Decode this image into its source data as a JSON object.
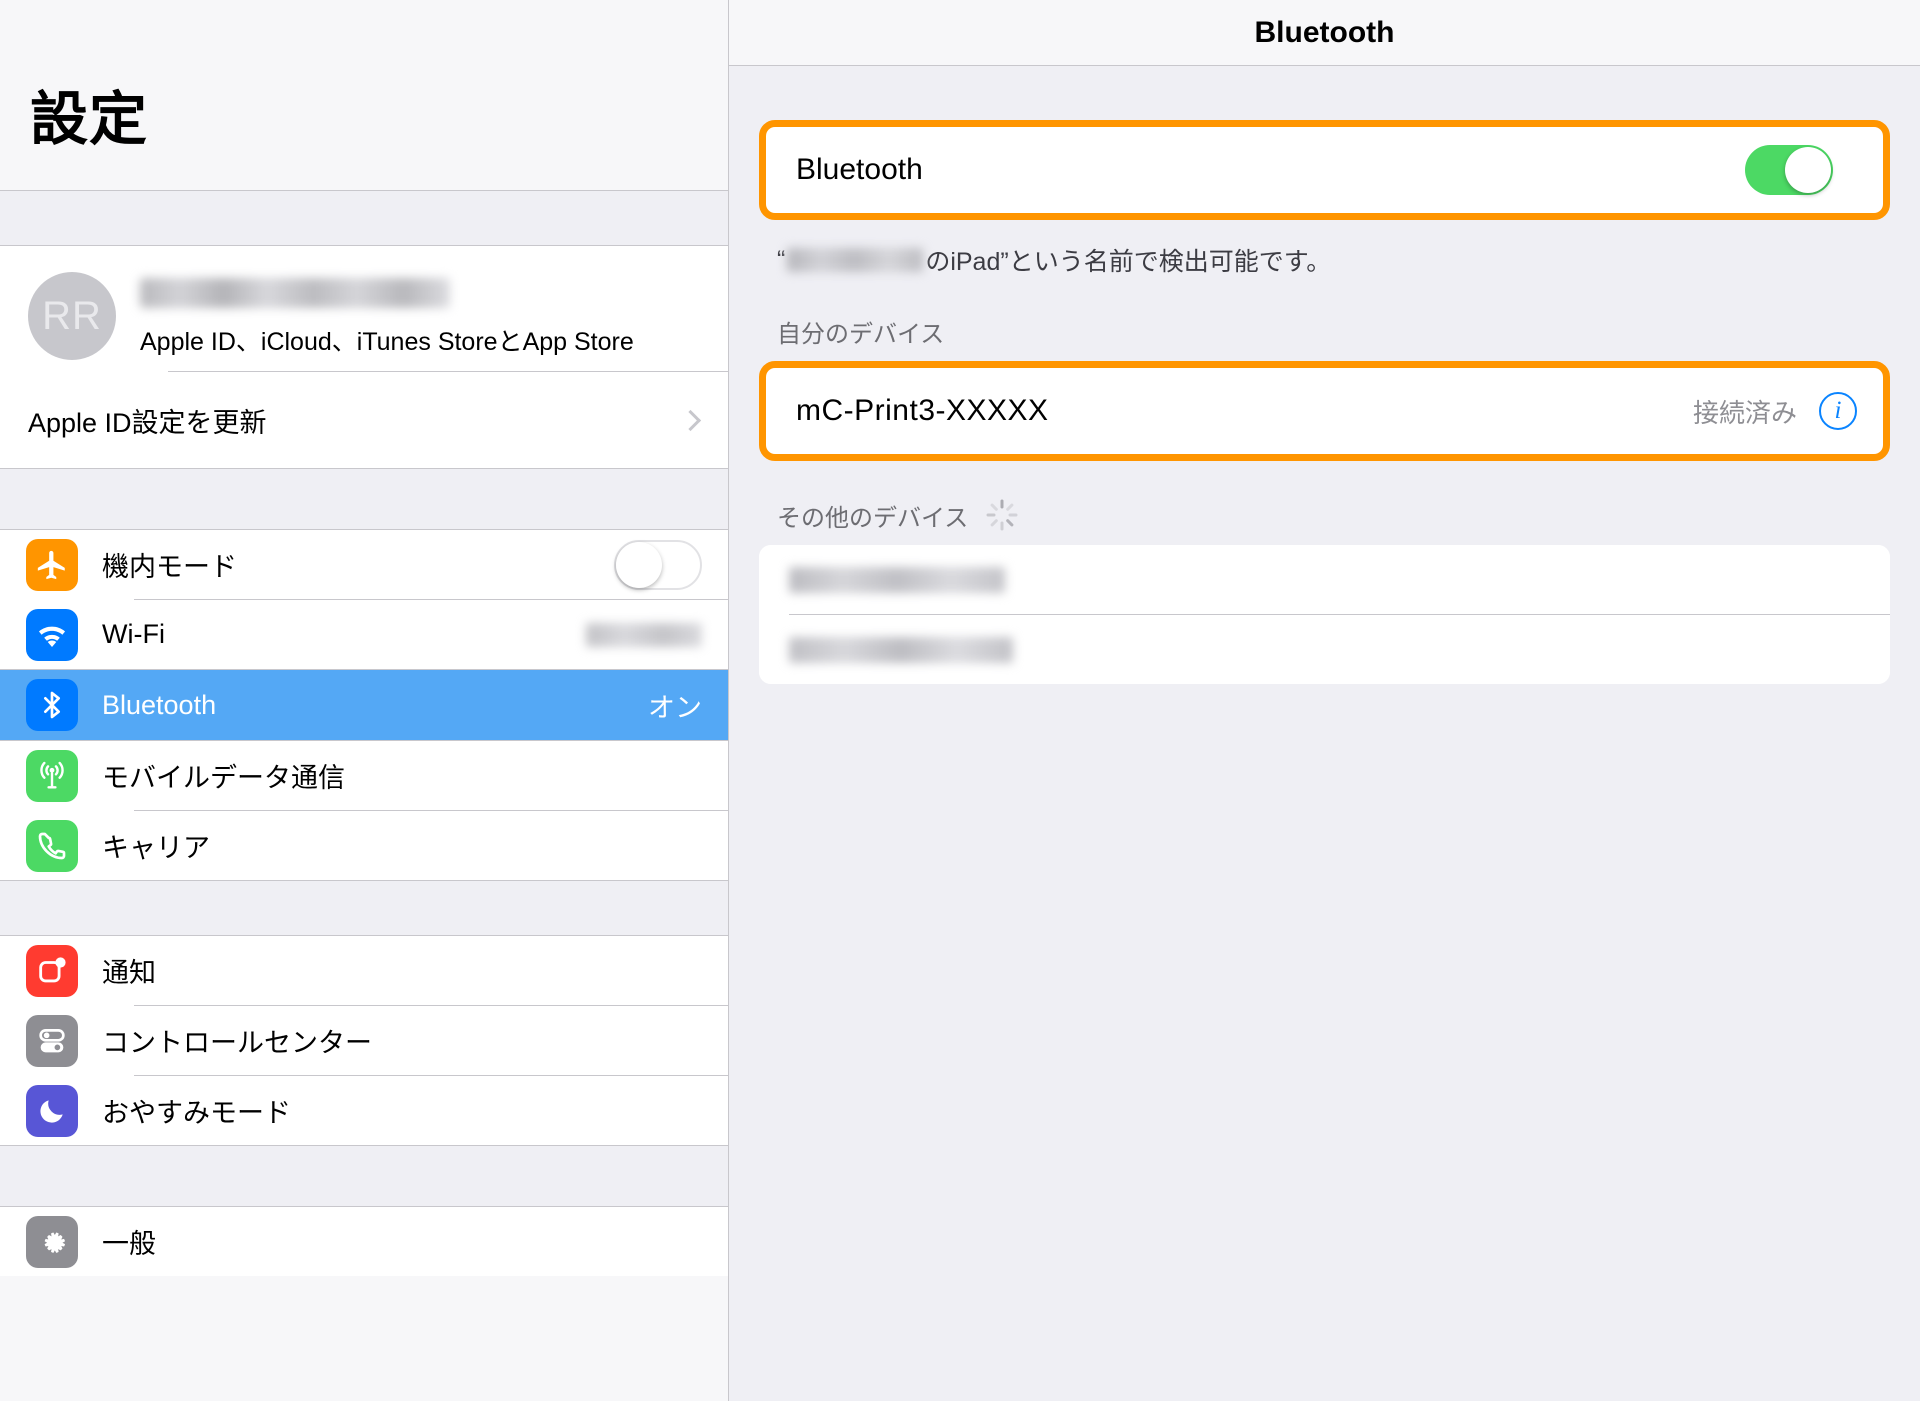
{
  "sidebar": {
    "title": "設定",
    "account": {
      "avatar_initials": "RR",
      "name_redacted": "",
      "subtitle": "Apple ID、iCloud、iTunes StoreとApp Store"
    },
    "update_apple_id": {
      "label": "Apple ID設定を更新"
    },
    "items": [
      {
        "label": "機内モード",
        "icon": "airplane-icon",
        "icon_color": "#ff9500",
        "value": "",
        "toggle": "off"
      },
      {
        "label": "Wi-Fi",
        "icon": "wifi-icon",
        "icon_color": "#007aff",
        "value": ""
      },
      {
        "label": "Bluetooth",
        "icon": "bluetooth-icon",
        "icon_color": "#007aff",
        "value": "オン",
        "selected": true
      },
      {
        "label": "モバイルデータ通信",
        "icon": "cellular-antenna-icon",
        "icon_color": "#4cd964",
        "value": ""
      },
      {
        "label": "キャリア",
        "icon": "phone-icon",
        "icon_color": "#4cd964",
        "value": ""
      },
      {
        "label": "通知",
        "icon": "notification-icon",
        "icon_color": "#ff3b30",
        "value": ""
      },
      {
        "label": "コントロールセンター",
        "icon": "control-center-icon",
        "icon_color": "#8e8e93",
        "value": ""
      },
      {
        "label": "おやすみモード",
        "icon": "moon-icon",
        "icon_color": "#5856d6",
        "value": ""
      },
      {
        "label": "一般",
        "icon": "gear-icon",
        "icon_color": "#8e8e93",
        "value": ""
      }
    ]
  },
  "detail": {
    "title": "Bluetooth",
    "bluetooth_toggle": {
      "label": "Bluetooth",
      "state": "on"
    },
    "discoverable_prefix": "“",
    "discoverable_suffix": "のiPad”という名前で検出可能です。",
    "my_devices_label": "自分のデバイス",
    "my_devices": [
      {
        "name": "mC-Print3-XXXXX",
        "status": "接続済み",
        "info_glyph": "i"
      }
    ],
    "other_devices_label": "その他のデバイス",
    "other_devices": [
      {
        "name_redacted": ""
      },
      {
        "name_redacted": ""
      }
    ]
  },
  "colors": {
    "highlight": "#ff9500",
    "selection": "#54a8f5",
    "toggle_on": "#4cd964",
    "accent_blue": "#007aff"
  }
}
